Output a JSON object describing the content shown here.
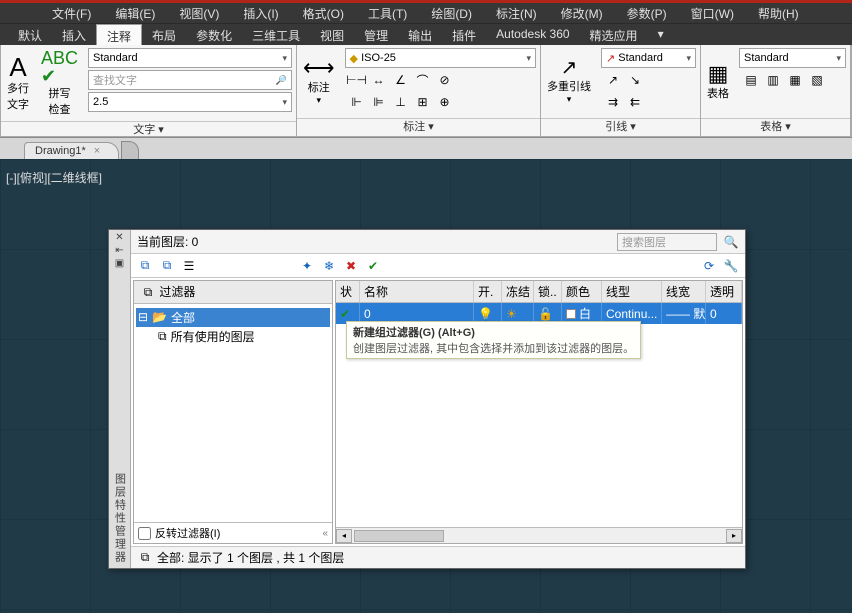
{
  "menubar": [
    "文件(F)",
    "编辑(E)",
    "视图(V)",
    "插入(I)",
    "格式(O)",
    "工具(T)",
    "绘图(D)",
    "标注(N)",
    "修改(M)",
    "参数(P)",
    "窗口(W)",
    "帮助(H)"
  ],
  "ribtabs": [
    "默认",
    "插入",
    "注释",
    "布局",
    "参数化",
    "三维工具",
    "视图",
    "管理",
    "输出",
    "插件",
    "Autodesk 360",
    "精选应用"
  ],
  "ribtab_active": 2,
  "ribbon": {
    "text_panel": {
      "big": "多行\n文字",
      "spellcheck": "拼写\n检查",
      "style": "Standard",
      "find_placeholder": "查找文字",
      "height": "2.5",
      "label": "文字"
    },
    "dim_panel": {
      "style": "ISO-25",
      "label": "标注",
      "big": "标注"
    },
    "leader_panel": {
      "style": "Standard",
      "big": "多重引线",
      "label": "引线"
    },
    "table_panel": {
      "style": "Standard",
      "big": "表格",
      "label": "表格"
    }
  },
  "doctab": {
    "name": "Drawing1*"
  },
  "viewport_label": "[-][俯视][二维线框]",
  "layer_mgr": {
    "current": "当前图层: 0",
    "search_placeholder": "搜索图层",
    "tree_header": "过滤器",
    "tree_all": "全部",
    "tree_used": "所有使用的图层",
    "tree_invert": "反转过滤器(I)",
    "tooltip_title": "新建组过滤器(G) (Alt+G)",
    "tooltip_body": "创建图层过滤器, 其中包含选择并添加到该过滤器的图层。",
    "cols": {
      "status": "状",
      "name": "名称",
      "on": "开.",
      "freeze": "冻结",
      "lock": "锁..",
      "color": "颜色",
      "ltype": "线型",
      "lweight": "线宽",
      "trans": "透明"
    },
    "row": {
      "name": "0",
      "color": "白",
      "ltype": "Continu...",
      "lweight": "——  默认",
      "trans": "0"
    },
    "status": "全部: 显示了 1 个图层 , 共 1 个图层",
    "side_title": "图层特性管理器"
  }
}
